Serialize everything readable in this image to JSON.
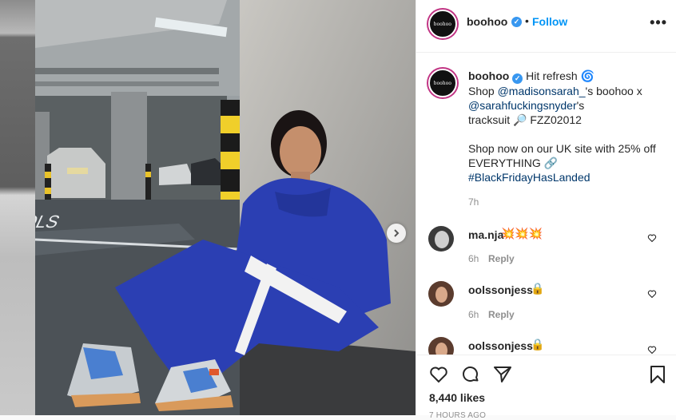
{
  "post": {
    "username": "boohoo",
    "verified_mark": "✓",
    "separator": "•",
    "follow_label": "Follow",
    "more_label": "•••",
    "avatar_text": "boohoo",
    "caption": {
      "username": "boohoo",
      "line1_text": "Hit refresh",
      "line1_emoji": "🌀",
      "shop_word": "Shop",
      "mention1": "@madisonsarah_",
      "after_mention1": "'s boohoo x",
      "mention2": "@sarahfuckingsnyder",
      "after_mention2": "'s",
      "tracksuit_text": "tracksuit",
      "key_emoji": "🔎",
      "code": "FZZ02012",
      "para2_line1": "Shop now on our UK site with 25% off",
      "para2_line2": "EVERYTHING",
      "para2_emoji": "🔗",
      "hashtag": "#BlackFridayHasLanded",
      "time": "7h"
    },
    "comments": [
      {
        "username": "ma.nja",
        "text": "💥💥💥",
        "time": "6h",
        "reply_label": "Reply"
      },
      {
        "username": "oolssonjess",
        "text": "🔒",
        "time": "6h",
        "reply_label": "Reply"
      },
      {
        "username": "oolssonjess",
        "text": "🔒",
        "time": "",
        "reply_label": ""
      }
    ],
    "likes": "8,440 likes",
    "posted_ago": "7 HOURS AGO"
  },
  "icons": {
    "like": "heart-icon",
    "comment": "comment-icon",
    "share": "share-icon",
    "save": "bookmark-icon",
    "next": "chevron-right-icon"
  },
  "colors": {
    "accent": "#0095f6",
    "link": "#00376b",
    "verified": "#3897f0",
    "jacket": "#2b3fb3"
  }
}
